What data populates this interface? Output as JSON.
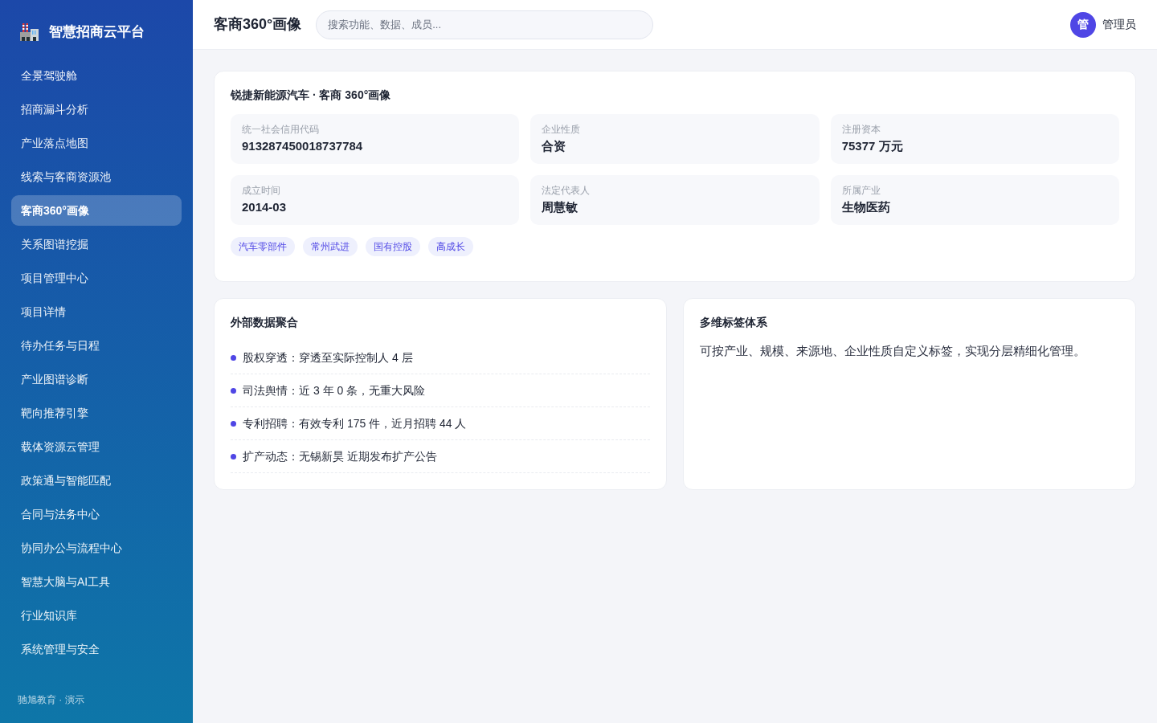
{
  "sidebar": {
    "brand": "智慧招商云平台",
    "items": [
      {
        "label": "全景驾驶舱",
        "selected": false
      },
      {
        "label": "招商漏斗分析",
        "selected": false
      },
      {
        "label": "产业落点地图",
        "selected": false
      },
      {
        "label": "线索与客商资源池",
        "selected": false
      },
      {
        "label": "客商360°画像",
        "selected": true
      },
      {
        "label": "关系图谱挖掘",
        "selected": false
      },
      {
        "label": "项目管理中心",
        "selected": false
      },
      {
        "label": "项目详情",
        "selected": false
      },
      {
        "label": "待办任务与日程",
        "selected": false
      },
      {
        "label": "产业图谱诊断",
        "selected": false
      },
      {
        "label": "靶向推荐引擎",
        "selected": false
      },
      {
        "label": "载体资源云管理",
        "selected": false
      },
      {
        "label": "政策通与智能匹配",
        "selected": false
      },
      {
        "label": "合同与法务中心",
        "selected": false
      },
      {
        "label": "协同办公与流程中心",
        "selected": false
      },
      {
        "label": "智慧大脑与AI工具",
        "selected": false
      },
      {
        "label": "行业知识库",
        "selected": false
      },
      {
        "label": "系统管理与安全",
        "selected": false
      }
    ],
    "footer": "驰旭教育 · 演示"
  },
  "topbar": {
    "title": "客商360°画像",
    "search": {
      "placeholder": "搜索功能、数据、成员..."
    },
    "user": {
      "avatar": "管",
      "name": "管理员"
    }
  },
  "profile_card": {
    "title": "锐捷新能源汽车 · 客商 360°画像",
    "fields": [
      {
        "label": "统一社会信用代码",
        "value": "913287450018737784"
      },
      {
        "label": "企业性质",
        "value": "合资"
      },
      {
        "label": "注册资本",
        "value": "75377 万元"
      },
      {
        "label": "成立时间",
        "value": "2014-03"
      },
      {
        "label": "法定代表人",
        "value": "周慧敏"
      },
      {
        "label": "所属产业",
        "value": "生物医药"
      }
    ],
    "tags": [
      "汽车零部件",
      "常州武进",
      "国有控股",
      "高成长"
    ]
  },
  "external_data": {
    "title": "外部数据聚合",
    "items": [
      "股权穿透：穿透至实际控制人 4 层",
      "司法舆情：近 3 年 0 条，无重大风险",
      "专利招聘：有效专利 175 件，近月招聘 44 人",
      "扩产动态：无锡新昊 近期发布扩产公告"
    ]
  },
  "tag_system": {
    "title": "多维标签体系",
    "text": "可按产业、规模、来源地、企业性质自定义标签，实现分层精细化管理。"
  }
}
